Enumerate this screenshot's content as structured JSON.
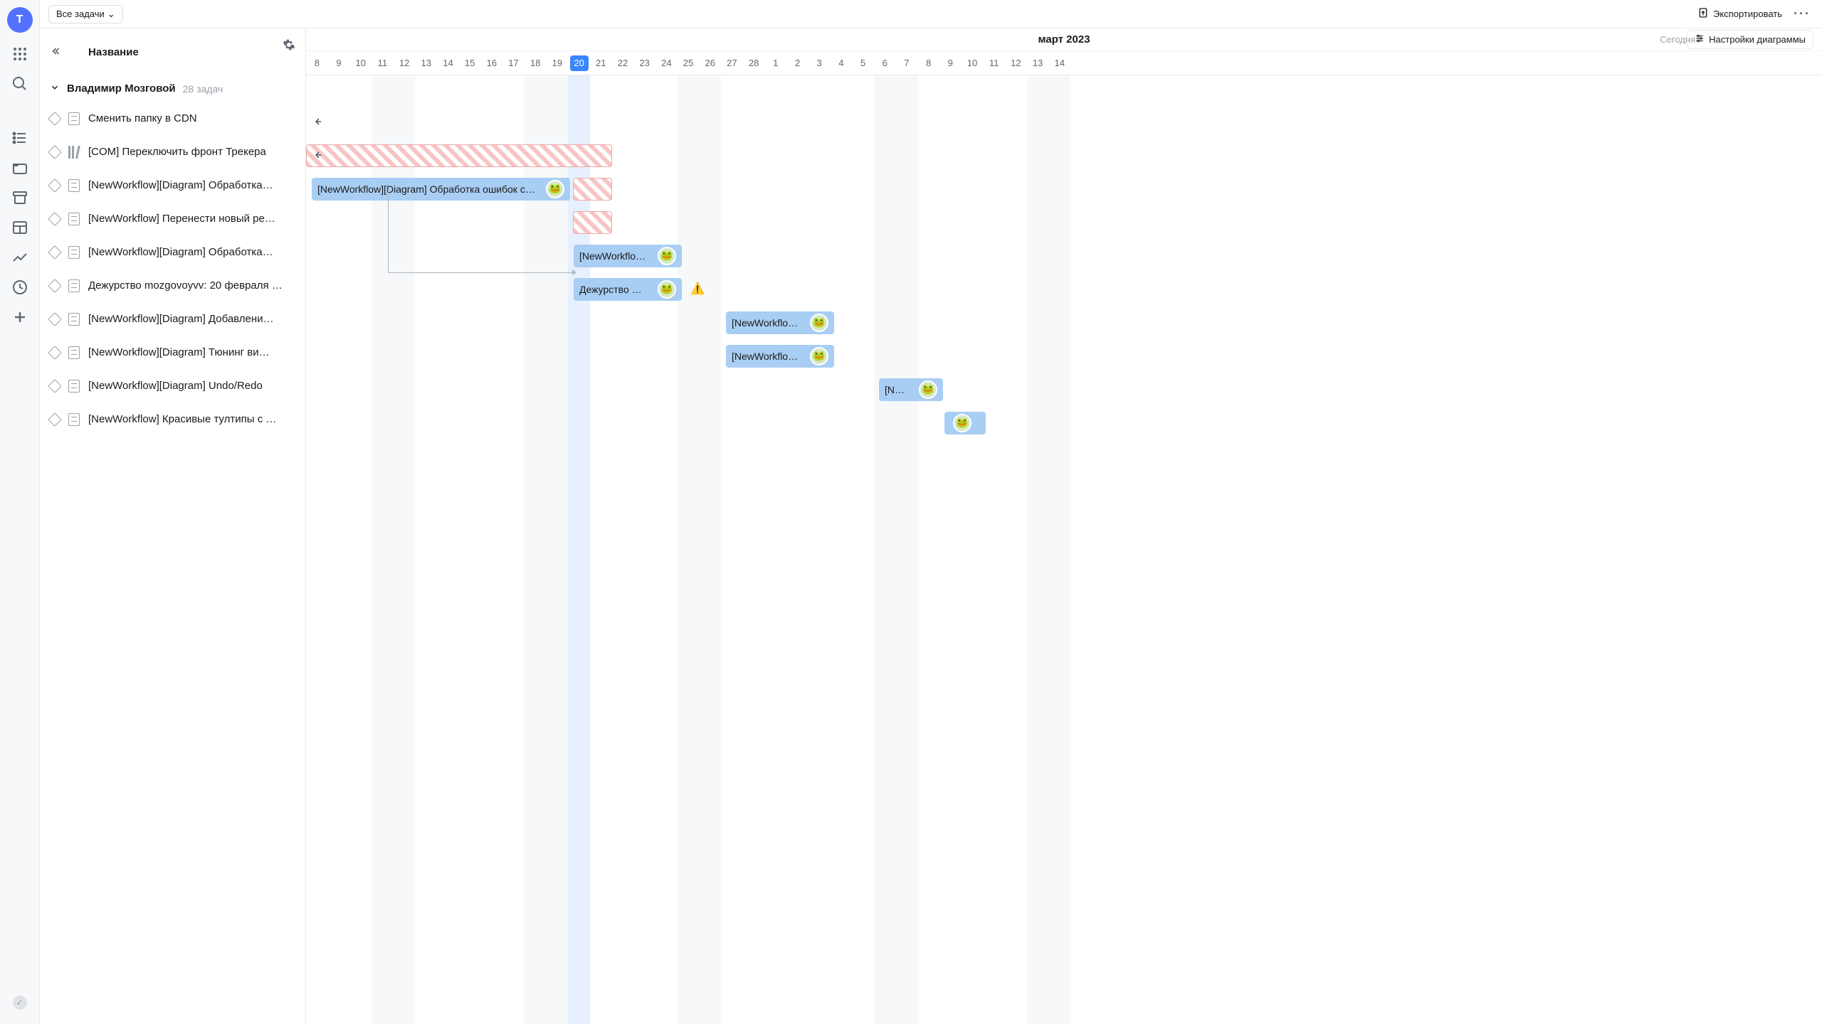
{
  "rail": {
    "logo": "T"
  },
  "topbar": {
    "filter_label": "Все задачи",
    "export_label": "Экспортировать"
  },
  "sidebar": {
    "title": "Название",
    "group_name": "Владимир Мозговой",
    "group_count": "28 задач",
    "tasks": [
      "Сменить папку в CDN",
      "[COM] Переключить фронт Трекера",
      "[NewWorkflow][Diagram] Обработка…",
      "[NewWorkflow] Перенести новый ре…",
      "[NewWorkflow][Diagram] Обработка…",
      "Дежурство mozgovoyvv: 20 февраля …",
      "[NewWorkflow][Diagram] Добавлени…",
      "[NewWorkflow][Diagram] Тюнинг ви…",
      "[NewWorkflow][Diagram] Undo/Redo",
      "[NewWorkflow] Красивые тултипы с …"
    ]
  },
  "chart": {
    "month": "март 2023",
    "today_label": "Сегодня",
    "settings_label": "Настройки диаграммы",
    "days": [
      "8",
      "9",
      "10",
      "11",
      "12",
      "13",
      "14",
      "15",
      "16",
      "17",
      "18",
      "19",
      "20",
      "21",
      "22",
      "23",
      "24",
      "25",
      "26",
      "27",
      "28",
      "1",
      "2",
      "3",
      "4",
      "5",
      "6",
      "7",
      "8",
      "9",
      "10",
      "11",
      "12",
      "13",
      "14"
    ],
    "today_index": 12,
    "bars": {
      "b3_label": "[NewWorkflow][Diagram] Обработка ошибок c…",
      "b5_label": "[NewWorkflo…",
      "b6_label": "Дежурство …",
      "b7_label": "[NewWorkflo…",
      "b8_label": "[NewWorkflo…",
      "b9_label": "[N…"
    }
  }
}
